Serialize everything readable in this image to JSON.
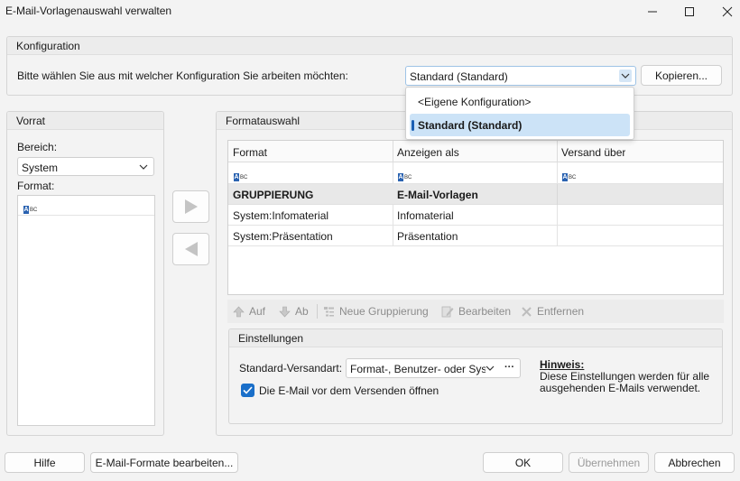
{
  "window": {
    "title": "E-Mail-Vorlagenauswahl verwalten"
  },
  "konfiguration": {
    "title": "Konfiguration",
    "prompt": "Bitte wählen Sie aus mit welcher Konfiguration Sie arbeiten möchten:",
    "selected": "Standard (Standard)",
    "copy_button": "Kopieren...",
    "options": [
      "<Eigene Konfiguration>",
      "Standard (Standard)"
    ]
  },
  "vorrat": {
    "title": "Vorrat",
    "bereich_label": "Bereich:",
    "bereich_value": "System",
    "format_label": "Format:"
  },
  "formatauswahl": {
    "title": "Formatauswahl",
    "columns": [
      "Format",
      "Anzeigen als",
      "Versand über"
    ],
    "rows": [
      {
        "format": "GRUPPIERUNG",
        "anzeigen": "E-Mail-Vorlagen",
        "versand": "",
        "group": true
      },
      {
        "format": "System:Infomaterial",
        "anzeigen": "Infomaterial",
        "versand": "",
        "group": false
      },
      {
        "format": "System:Präsentation",
        "anzeigen": "Präsentation",
        "versand": "",
        "group": false
      }
    ],
    "toolbar": {
      "up": "Auf",
      "down": "Ab",
      "new_group": "Neue Gruppierung",
      "edit": "Bearbeiten",
      "remove": "Entfernen"
    }
  },
  "einstellungen": {
    "title": "Einstellungen",
    "versandart_label": "Standard-Versandart:",
    "versandart_value": "Format-, Benutzer- oder Sys...",
    "more_button": "···",
    "checkbox_label": "Die E-Mail vor dem Versenden öffnen",
    "checkbox_checked": true,
    "hint_title": "Hinweis:",
    "hint_line1": "Diese Einstellungen werden für alle",
    "hint_line2": "ausgehenden E-Mails verwendet."
  },
  "footer": {
    "help": "Hilfe",
    "edit_formats": "E-Mail-Formate bearbeiten...",
    "ok": "OK",
    "apply": "Übernehmen",
    "cancel": "Abbrechen"
  },
  "icons": {
    "abc_letter": "A",
    "abc_small": "BC"
  },
  "colors": {
    "accent": "#1a6fc9",
    "selection": "#cce3f7",
    "group_row": "#e8e8e8"
  }
}
